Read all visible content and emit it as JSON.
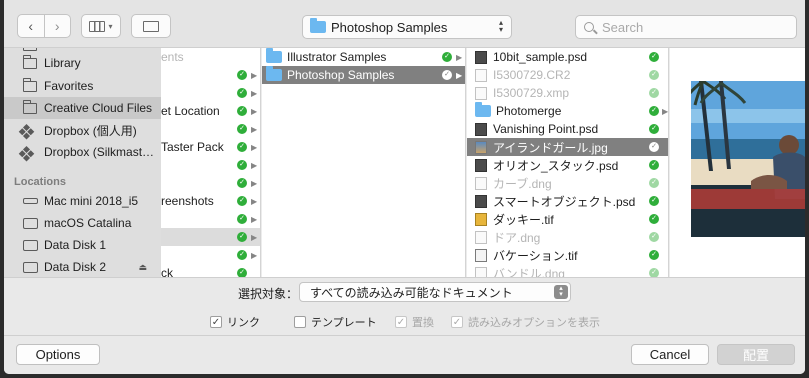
{
  "toolbar": {
    "back_icon": "chevron-left-icon",
    "forward_icon": "chevron-right-icon",
    "path_popup": "Photoshop Samples",
    "search_placeholder": "Search"
  },
  "sidebar": {
    "partial_top": "...",
    "items": [
      {
        "label": "Library",
        "icon": "folder-icon"
      },
      {
        "label": "Favorites",
        "icon": "folder-icon"
      },
      {
        "label": "Creative Cloud Files",
        "icon": "folder-icon",
        "selected": true
      },
      {
        "label": "Dropbox (個人用)",
        "icon": "dropbox-icon"
      },
      {
        "label": "Dropbox (Silkmast…",
        "icon": "dropbox-icon"
      }
    ],
    "locations_header": "Locations",
    "locations": [
      {
        "label": "Mac mini 2018_i5",
        "icon": "computer-icon"
      },
      {
        "label": "macOS Catalina",
        "icon": "disk-icon"
      },
      {
        "label": "Data Disk 1",
        "icon": "disk-icon"
      },
      {
        "label": "Data Disk 2",
        "icon": "disk-icon",
        "eject": true
      }
    ]
  },
  "column1": {
    "rows": [
      "ents",
      "",
      "et Location",
      "",
      "Taster Pack",
      "",
      "reenshots",
      "",
      "",
      "",
      "ck"
    ]
  },
  "column2": {
    "rows": [
      {
        "label": "Illustrator Samples"
      },
      {
        "label": "Photoshop Samples",
        "selected": true
      }
    ]
  },
  "column3": {
    "rows": [
      {
        "label": "10bit_sample.psd",
        "type": "psd"
      },
      {
        "label": "I5300729.CR2",
        "type": "raw",
        "dim": true
      },
      {
        "label": "I5300729.xmp",
        "type": "doc",
        "dim": true
      },
      {
        "label": "Photomerge",
        "type": "folder"
      },
      {
        "label": "Vanishing Point.psd",
        "type": "psd"
      },
      {
        "label": "アイランドガール.jpg",
        "type": "img",
        "selected": true
      },
      {
        "label": "オリオン_スタック.psd",
        "type": "psd"
      },
      {
        "label": "カーブ.dng",
        "type": "raw",
        "dim": true
      },
      {
        "label": "スマートオブジェクト.psd",
        "type": "psd"
      },
      {
        "label": "ダッキー.tif",
        "type": "tif"
      },
      {
        "label": "ドア.dng",
        "type": "raw",
        "dim": true
      },
      {
        "label": "バケーション.tif",
        "type": "tif"
      },
      {
        "label": "バンドル.dng",
        "type": "raw",
        "dim": true
      }
    ]
  },
  "options": {
    "select_label": "選択対象：",
    "select_value": "すべての読み込み可能なドキュメント",
    "checkboxes": [
      {
        "label": "リンク",
        "checked": true,
        "disabled": false
      },
      {
        "label": "テンプレート",
        "checked": false,
        "disabled": false
      },
      {
        "label": "置換",
        "checked": true,
        "disabled": true
      },
      {
        "label": "読み込みオプションを表示",
        "checked": true,
        "disabled": true
      }
    ]
  },
  "footer": {
    "options_button": "Options",
    "cancel_button": "Cancel",
    "place_button": "配置"
  },
  "colors": {
    "selection": "#808080",
    "sidebar_selection": "#c9c9c9",
    "sync_check": "#2fae3a"
  }
}
